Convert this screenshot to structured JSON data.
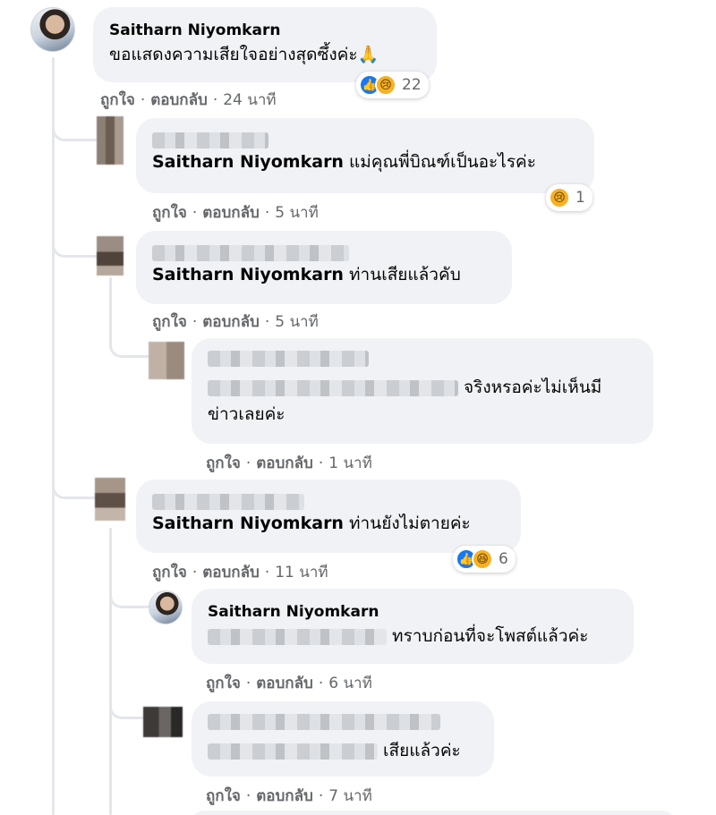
{
  "comment_actions": {
    "like": "ถูกใจ",
    "reply": "ตอบกลับ",
    "separator": "·"
  },
  "comments": [
    {
      "author": "Saitharn Niyomkarn",
      "text": "ขอแสดงความเสียใจอย่างสุดซึ้งค่ะ🙏",
      "time": "24 นาที",
      "reaction_count": "22",
      "reactions": [
        "like-icon",
        "sad-icon"
      ]
    },
    {
      "author_redacted": true,
      "mention": "Saitharn Niyomkarn",
      "text": "แม่คุณพี่บิณฑ์เป็นอะไรค่ะ",
      "time": "5 นาที",
      "reaction_count": "1",
      "reactions": [
        "sad-icon"
      ]
    },
    {
      "author_redacted": true,
      "mention": "Saitharn Niyomkarn",
      "text": "ท่านเสียแล้วคับ",
      "time": "5 นาที"
    },
    {
      "author_redacted": true,
      "text_visible_part": "จริงหรอค่ะไม่เห็นมี",
      "text_line2": "ข่าวเลยค่ะ",
      "time": "1 นาที"
    },
    {
      "author_redacted": true,
      "mention": "Saitharn Niyomkarn",
      "text": "ท่านยังไม่ตายค่ะ",
      "time": "11 นาที",
      "reaction_count": "6",
      "reactions": [
        "like-icon",
        "haha-icon"
      ]
    },
    {
      "author": "Saitharn Niyomkarn",
      "text_visible_part": "ทราบก่อนที่จะโพสต์แล้วค่ะ",
      "time": "6 นาที"
    },
    {
      "author_redacted": true,
      "text_visible_part": "เสียแล้วค่ะ",
      "time": "7 นาที"
    }
  ],
  "colors": {
    "bubble": "#f0f2f5",
    "meta_text": "#65676b",
    "like_blue": "#1877f2",
    "emoji_yellow": "#f7b125",
    "thread_line": "#e4e6eb"
  }
}
